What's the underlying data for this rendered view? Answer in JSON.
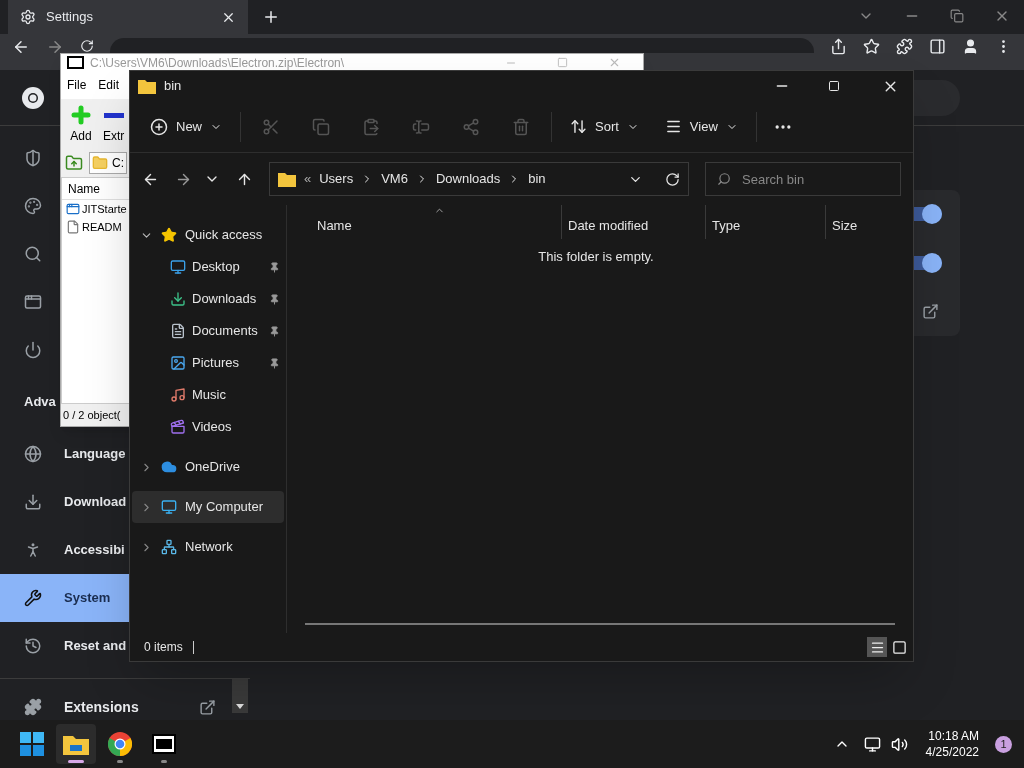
{
  "chrome": {
    "tab": {
      "title": "Settings"
    },
    "section_title": "Adva",
    "nav_items": [
      {
        "label": "Language",
        "selected": false
      },
      {
        "label": "Download",
        "selected": false
      },
      {
        "label": "Accessibi",
        "selected": false
      },
      {
        "label": "System",
        "selected": true
      },
      {
        "label": "Reset and",
        "selected": false
      }
    ],
    "extensions": {
      "label": "Extensions"
    },
    "toggles": [
      {
        "on": true
      },
      {
        "on": true
      }
    ]
  },
  "sevenzip": {
    "title": "C:\\Users\\VM6\\Downloads\\Electron.zip\\Electron\\",
    "menu": [
      "File",
      "Edit"
    ],
    "tools": [
      {
        "kind": "add",
        "label": "Add"
      },
      {
        "kind": "extract",
        "label": "Extr"
      }
    ],
    "path": "C:",
    "column": "Name",
    "files": [
      {
        "kind": "program",
        "name": "JITStarte"
      },
      {
        "kind": "text",
        "name": "READM"
      }
    ],
    "status": "0 / 2 object("
  },
  "explorer": {
    "title": "bin",
    "new_label": "New",
    "sort_label": "Sort",
    "view_label": "View",
    "breadcrumb_overflow": "«",
    "breadcrumb": [
      "Users",
      "VM6",
      "Downloads",
      "bin"
    ],
    "search": {
      "placeholder": "Search bin"
    },
    "tree": [
      {
        "label": "Quick access",
        "expanded": true,
        "selected": false,
        "children": [
          {
            "label": "Desktop",
            "pinned": true
          },
          {
            "label": "Downloads",
            "pinned": true
          },
          {
            "label": "Documents",
            "pinned": true
          },
          {
            "label": "Pictures",
            "pinned": true
          },
          {
            "label": "Music",
            "pinned": false
          },
          {
            "label": "Videos",
            "pinned": false
          }
        ]
      },
      {
        "label": "OneDrive",
        "expanded": false,
        "selected": false
      },
      {
        "label": "My Computer",
        "expanded": false,
        "selected": true
      },
      {
        "label": "Network",
        "expanded": false,
        "selected": false
      }
    ],
    "columns": [
      {
        "label": "Name",
        "sorted": true
      },
      {
        "label": "Date modified",
        "sorted": false
      },
      {
        "label": "Type",
        "sorted": false
      },
      {
        "label": "Size",
        "sorted": false
      }
    ],
    "empty_message": "This folder is empty.",
    "status": "0 items",
    "view_buttons": [
      {
        "kind": "details",
        "selected": true
      },
      {
        "kind": "tiles",
        "selected": false
      }
    ]
  },
  "taskbar": {
    "apps": [
      {
        "kind": "start",
        "active": false
      },
      {
        "kind": "explorer",
        "active": true
      },
      {
        "kind": "chrome",
        "active": false
      },
      {
        "kind": "sevenzip",
        "active": false
      }
    ],
    "time": "10:18 AM",
    "date": "4/25/2022",
    "notifications": "1"
  }
}
